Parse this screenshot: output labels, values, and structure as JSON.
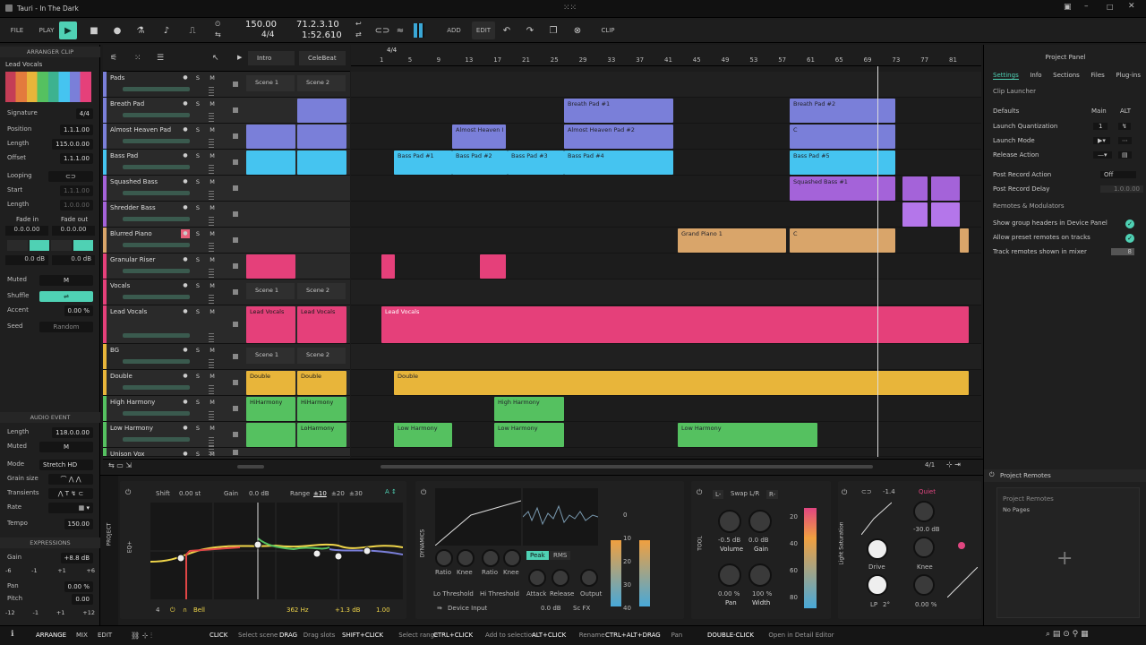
{
  "window": {
    "title": "Tauri - In The Dark"
  },
  "toolbar": {
    "file": "FILE",
    "play": "PLAY",
    "tempo": "150.00",
    "signature": "4/4",
    "position": "71.2.3.10",
    "time": "1:52.610",
    "add": "ADD",
    "edit": "EDIT",
    "clip": "CLIP"
  },
  "inspector": {
    "header": "ARRANGER CLIP",
    "clip_name": "Lead Vocals",
    "signature_label": "Signature",
    "signature": "4/4",
    "position_label": "Position",
    "position": "1.1.1.00",
    "length_label": "Length",
    "length": "115.0.0.00",
    "offset_label": "Offset",
    "offset": "1.1.1.00",
    "looping_label": "Looping",
    "start_label": "Start",
    "start": "1.1.1.00",
    "loop_length_label": "Length",
    "loop_length": "1.0.0.00",
    "fadein_label": "Fade in",
    "fadeout_label": "Fade out",
    "fadein": "0.0.0.00",
    "fadeout": "0.0.0.00",
    "gain1": "0.0 dB",
    "gain2": "0.0 dB",
    "muted_label": "Muted",
    "muted_btn": "M",
    "shuffle_label": "Shuffle",
    "accent_label": "Accent",
    "accent": "0.00 %",
    "seed_label": "Seed",
    "seed": "Random",
    "audio_header": "AUDIO EVENT",
    "ae_length_label": "Length",
    "ae_length": "118.0.0.00",
    "ae_muted_label": "Muted",
    "ae_muted": "M",
    "mode_label": "Mode",
    "mode": "Stretch HD",
    "grain_label": "Grain size",
    "transients_label": "Transients",
    "rate_label": "Rate",
    "tempo_label": "Tempo",
    "tempo": "150.00",
    "expr_header": "EXPRESSIONS",
    "gain_label": "Gain",
    "gain": "+8.8 dB",
    "pan_label": "Pan",
    "pan": "0.00 %",
    "pitch_label": "Pitch",
    "pitch": "0.00",
    "semis1": [
      "-6",
      "-1",
      "+1",
      "+6"
    ],
    "semis2": [
      "-12",
      "-1",
      "+1",
      "+12"
    ]
  },
  "tracks": [
    {
      "name": "Pads",
      "color": "#7a7fd9",
      "h": 29,
      "group": true
    },
    {
      "name": "Breath Pad",
      "color": "#7a7fd9",
      "h": 29
    },
    {
      "name": "Almost Heaven Pad",
      "color": "#7a7fd9",
      "h": 29
    },
    {
      "name": "Bass Pad",
      "color": "#45c4f0",
      "h": 29
    },
    {
      "name": "Squashed Bass",
      "color": "#a463d9",
      "h": 29
    },
    {
      "name": "Shredder Bass",
      "color": "#a463d9",
      "h": 29
    },
    {
      "name": "Blurred Piano",
      "color": "#d9a56a",
      "h": 29
    },
    {
      "name": "Granular Riser",
      "color": "#e5407a",
      "h": 29
    },
    {
      "name": "Vocals",
      "color": "#e5407a",
      "h": 29,
      "group": true
    },
    {
      "name": "Lead Vocals",
      "color": "#e5407a",
      "h": 43
    },
    {
      "name": "BG",
      "color": "#e8b53a",
      "h": 29,
      "group": true
    },
    {
      "name": "Double",
      "color": "#e8b53a",
      "h": 29
    },
    {
      "name": "High Harmony",
      "color": "#55c160",
      "h": 29
    },
    {
      "name": "Low Harmony",
      "color": "#55c160",
      "h": 29
    },
    {
      "name": "Unison Vox",
      "color": "#55c160",
      "h": 10
    }
  ],
  "scenes": {
    "col1": "Intro",
    "col2": "CeleBeat",
    "scene1": "Scene 1",
    "scene2": "Scene 2"
  },
  "launcher_clips": [
    {
      "row": 1,
      "col": 2,
      "color": "#7a7fd9",
      "label": ""
    },
    {
      "row": 2,
      "col": 1,
      "color": "#7a7fd9",
      "label": ""
    },
    {
      "row": 2,
      "col": 2,
      "color": "#7a7fd9",
      "label": ""
    },
    {
      "row": 3,
      "col": 1,
      "color": "#45c4f0",
      "label": ""
    },
    {
      "row": 3,
      "col": 2,
      "color": "#45c4f0",
      "label": ""
    },
    {
      "row": 7,
      "col": 1,
      "color": "#e5407a",
      "label": ""
    },
    {
      "row": 9,
      "col": 1,
      "color": "#e5407a",
      "label": "Lead Vocals"
    },
    {
      "row": 9,
      "col": 2,
      "color": "#e5407a",
      "label": "Lead Vocals"
    },
    {
      "row": 11,
      "col": 1,
      "color": "#e8b53a",
      "label": "Double"
    },
    {
      "row": 11,
      "col": 2,
      "color": "#e8b53a",
      "label": "Double"
    },
    {
      "row": 12,
      "col": 1,
      "color": "#55c160",
      "label": "HiHarmony"
    },
    {
      "row": 12,
      "col": 2,
      "color": "#55c160",
      "label": "HiHarmony"
    },
    {
      "row": 13,
      "col": 1,
      "color": "#55c160",
      "label": ""
    },
    {
      "row": 13,
      "col": 2,
      "color": "#55c160",
      "label": "LoHarmony"
    }
  ],
  "ruler": {
    "sig": "4/4",
    "bars": [
      "1",
      "5",
      "9",
      "13",
      "17",
      "21",
      "25",
      "29",
      "33",
      "37",
      "41",
      "45",
      "49",
      "53",
      "57",
      "61",
      "65",
      "69",
      "73",
      "77",
      "81"
    ]
  },
  "arr_clips": [
    {
      "row": 1,
      "s": 630,
      "e": 752,
      "c": "#7a7fd9",
      "l": "Breath Pad #1"
    },
    {
      "row": 1,
      "s": 882,
      "e": 1000,
      "c": "#7a7fd9",
      "l": "Breath Pad #2"
    },
    {
      "row": 2,
      "s": 505,
      "e": 565,
      "c": "#7a7fd9",
      "l": "Almost Heaven I"
    },
    {
      "row": 2,
      "s": 630,
      "e": 752,
      "c": "#7a7fd9",
      "l": "Almost Heaven Pad #2"
    },
    {
      "row": 2,
      "s": 882,
      "e": 1000,
      "c": "#7a7fd9",
      "l": "C"
    },
    {
      "row": 3,
      "s": 440,
      "e": 505,
      "c": "#45c4f0",
      "l": "Bass Pad #1"
    },
    {
      "row": 3,
      "s": 505,
      "e": 567,
      "c": "#45c4f0",
      "l": "Bass Pad #2"
    },
    {
      "row": 3,
      "s": 567,
      "e": 630,
      "c": "#45c4f0",
      "l": "Bass Pad #3"
    },
    {
      "row": 3,
      "s": 630,
      "e": 752,
      "c": "#45c4f0",
      "l": "Bass Pad #4"
    },
    {
      "row": 3,
      "s": 882,
      "e": 1000,
      "c": "#45c4f0",
      "l": "Bass Pad #5"
    },
    {
      "row": 4,
      "s": 882,
      "e": 1000,
      "c": "#a463d9",
      "l": "Squashed Bass #1"
    },
    {
      "row": 4,
      "s": 1008,
      "e": 1036,
      "c": "#a463d9",
      "l": ""
    },
    {
      "row": 4,
      "s": 1040,
      "e": 1072,
      "c": "#a463d9",
      "l": ""
    },
    {
      "row": 5,
      "s": 1008,
      "e": 1036,
      "c": "#b476ea",
      "l": ""
    },
    {
      "row": 5,
      "s": 1040,
      "e": 1072,
      "c": "#b476ea",
      "l": ""
    },
    {
      "row": 6,
      "s": 757,
      "e": 878,
      "c": "#d9a56a",
      "l": "Grand Piano 1"
    },
    {
      "row": 6,
      "s": 882,
      "e": 1000,
      "c": "#d9a56a",
      "l": "C"
    },
    {
      "row": 6,
      "s": 1072,
      "e": 1082,
      "c": "#d9a56a",
      "l": ""
    },
    {
      "row": 7,
      "s": 426,
      "e": 441,
      "c": "#e5407a",
      "l": ""
    },
    {
      "row": 7,
      "s": 536,
      "e": 565,
      "c": "#e5407a",
      "l": ""
    },
    {
      "row": 9,
      "s": 426,
      "e": 1082,
      "c": "#e5407a",
      "l": "Lead Vocals"
    },
    {
      "row": 11,
      "s": 440,
      "e": 1082,
      "c": "#e8b53a",
      "l": "Double"
    },
    {
      "row": 12,
      "s": 552,
      "e": 630,
      "c": "#55c160",
      "l": "High Harmony"
    },
    {
      "row": 13,
      "s": 440,
      "e": 505,
      "c": "#55c160",
      "l": "Low Harmony"
    },
    {
      "row": 13,
      "s": 552,
      "e": 630,
      "c": "#55c160",
      "l": "Low Harmony"
    },
    {
      "row": 13,
      "s": 757,
      "e": 913,
      "c": "#55c160",
      "l": "Low Harmony"
    }
  ],
  "right_panel": {
    "title": "Project Panel",
    "tabs": [
      "Settings",
      "Info",
      "Sections",
      "Files",
      "Plug-ins"
    ],
    "section": "Clip Launcher",
    "defaults_label": "Defaults",
    "main": "Main",
    "alt": "ALT",
    "launch_q": "Launch Quantization",
    "launch_q_val": "1",
    "launch_mode": "Launch Mode",
    "release_action": "Release Action",
    "post_record": "Post Record Action",
    "post_record_val": "Off",
    "post_record_delay": "Post Record Delay",
    "post_record_delay_val": "1.0.0.00",
    "remotes_section": "Remotes & Modulators",
    "opt1": "Show group headers in Device Panel",
    "opt2": "Allow preset remotes on tracks",
    "opt3": "Track remotes shown in mixer",
    "opt3_val": "8",
    "remotes_title": "Project Remotes",
    "remotes_sub": "Project Remotes",
    "no_pages": "No Pages"
  },
  "device": {
    "project": "PROJECT",
    "eq": "EQ+",
    "shift_label": "Shift",
    "shift": "0.00 st",
    "gain_label": "Gain",
    "gain": "0.0 dB",
    "range_label": "Range",
    "range_opts": [
      "±10",
      "±20",
      "±30"
    ],
    "band_num": "4",
    "band_type": "Bell",
    "freq": "362 Hz",
    "band_gain": "+1.3 dB",
    "q": "1.00",
    "dynamics": "DYNAMICS",
    "ratio1": "Ratio",
    "knee1": "Knee",
    "ratio2": "Ratio",
    "knee2": "Knee",
    "lo_thr": "Lo Threshold",
    "hi_thr": "Hi Threshold",
    "peak": "Peak",
    "rms": "RMS",
    "attack": "Attack",
    "release": "Release",
    "output": "Output",
    "device_input": "Device Input",
    "dyn_gain": "0.0 dB",
    "sc_fx": "Sc FX",
    "tool": "TOOL",
    "l": "L-",
    "swap": "Swap L/R",
    "r": "R-",
    "volume_val": "-0.5 dB",
    "volume": "Volume",
    "t_gain_val": "0.0 dB",
    "t_gain": "Gain",
    "pan_val": "0.00 %",
    "pan": "Pan",
    "width_val": "100 %",
    "width": "Width",
    "light_sat": "Light Saturation",
    "drive_val": "-1.4",
    "drive": "Drive",
    "quiet": "Quiet",
    "knee_val": "-30.0 dB",
    "knee": "Knee",
    "lp": "LP",
    "lp_val": "2°",
    "mix_val": "0.00 %",
    "meter1": [
      "0",
      "10",
      "20",
      "30",
      "40"
    ],
    "meter2": [
      "20",
      "40",
      "60",
      "80"
    ]
  },
  "status": {
    "views": [
      "ARRANGE",
      "MIX",
      "EDIT"
    ],
    "hints": [
      {
        "k": "CLICK",
        "v": "Select scene"
      },
      {
        "k": "DRAG",
        "v": "Drag slots"
      },
      {
        "k": "SHIFT+CLICK",
        "v": "Select range"
      },
      {
        "k": "CTRL+CLICK",
        "v": "Add to selection"
      },
      {
        "k": "ALT+CLICK",
        "v": "Rename"
      },
      {
        "k": "CTRL+ALT+DRAG",
        "v": "Pan"
      },
      {
        "k": "DOUBLE-CLICK",
        "v": "Open in Detail Editor"
      }
    ]
  },
  "bottom_bar": {
    "zoom": "4/1"
  }
}
